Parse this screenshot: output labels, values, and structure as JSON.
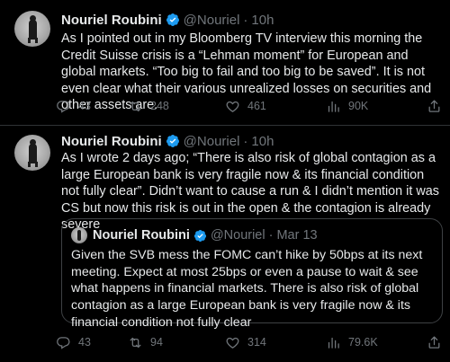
{
  "colors": {
    "background": "#000000",
    "text": "#e7e9ea",
    "muted": "#71767b",
    "verified_badge": "#1d9bf0",
    "divider": "#2f3336"
  },
  "tweets": [
    {
      "author": {
        "name": "Nouriel Roubini",
        "handle": "@Nouriel",
        "verified": true,
        "avatar_icon": "avatar-photo"
      },
      "separator": "·",
      "time": "10h",
      "text": "As I pointed out in my Bloomberg TV interview this morning the Credit Suisse crisis is a “Lehman moment” for European and global markets. “Too big to fail and too big to be saved”. It is not even clear what their various unrealized losses on securities and other assets are.",
      "actions": {
        "reply_count": "43",
        "retweet_count": "248",
        "like_count": "461",
        "views_count": "90K"
      }
    },
    {
      "author": {
        "name": "Nouriel Roubini",
        "handle": "@Nouriel",
        "verified": true,
        "avatar_icon": "avatar-photo"
      },
      "separator": "·",
      "time": "10h",
      "text": "As I wrote 2 days ago; “There is also risk of global contagion as a large European bank is very fragile now & its financial condition not fully clear”. Didn’t want to cause a run & I didn’t mention it was CS but now this risk is out in the open & the contagion is already severe",
      "quoted": {
        "name": "Nouriel Roubini",
        "handle": "@Nouriel",
        "separator": "·",
        "time": "Mar 13",
        "text": "Given the SVB mess the FOMC can’t hike by 50bps at its next meeting. Expect at most 25bps or even a pause to wait & see what happens in financial markets. There is also risk of global contagion as a large European bank is very fragile now & its financial condition not fully clear"
      },
      "actions": {
        "reply_count": "43",
        "retweet_count": "94",
        "like_count": "314",
        "views_count": "79.6K"
      }
    }
  ]
}
